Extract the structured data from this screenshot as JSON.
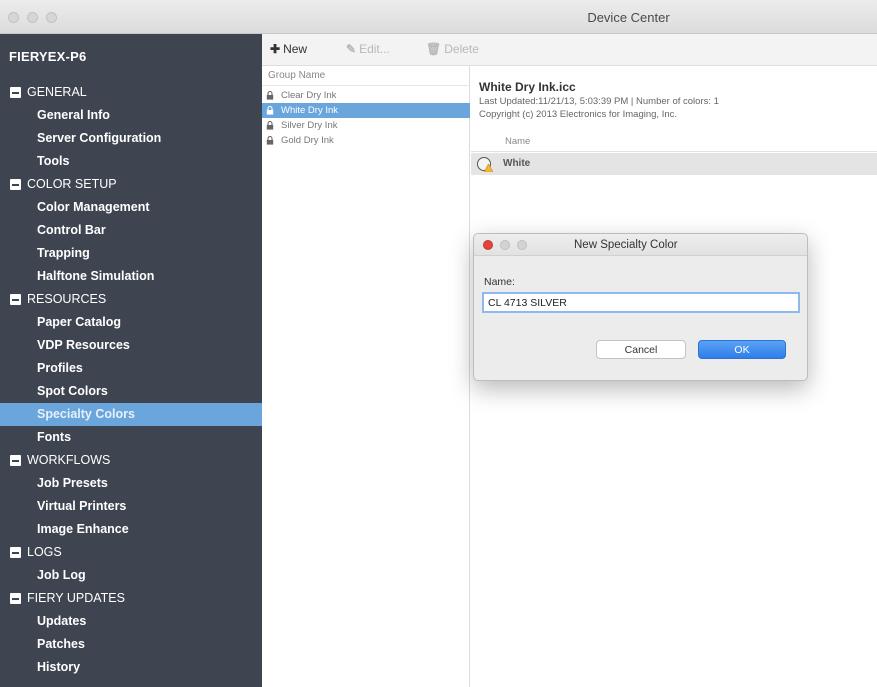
{
  "window": {
    "title": "Device Center"
  },
  "sidebar": {
    "device_name": "FIERYEX-P6",
    "nav": [
      {
        "type": "section",
        "label": "GENERAL"
      },
      {
        "type": "item",
        "label": "General Info"
      },
      {
        "type": "item",
        "label": "Server Configuration"
      },
      {
        "type": "item",
        "label": "Tools"
      },
      {
        "type": "section",
        "label": "COLOR SETUP"
      },
      {
        "type": "item",
        "label": "Color Management"
      },
      {
        "type": "item",
        "label": "Control Bar"
      },
      {
        "type": "item",
        "label": "Trapping"
      },
      {
        "type": "item",
        "label": "Halftone Simulation"
      },
      {
        "type": "section",
        "label": "RESOURCES"
      },
      {
        "type": "item",
        "label": "Paper Catalog"
      },
      {
        "type": "item",
        "label": "VDP Resources"
      },
      {
        "type": "item",
        "label": "Profiles"
      },
      {
        "type": "item",
        "label": "Spot Colors"
      },
      {
        "type": "item",
        "label": "Specialty Colors",
        "selected": true
      },
      {
        "type": "item",
        "label": "Fonts"
      },
      {
        "type": "section",
        "label": "WORKFLOWS"
      },
      {
        "type": "item",
        "label": "Job Presets"
      },
      {
        "type": "item",
        "label": "Virtual Printers"
      },
      {
        "type": "item",
        "label": "Image Enhance"
      },
      {
        "type": "section",
        "label": "LOGS"
      },
      {
        "type": "item",
        "label": "Job Log"
      },
      {
        "type": "section",
        "label": "FIERY UPDATES"
      },
      {
        "type": "item",
        "label": "Updates"
      },
      {
        "type": "item",
        "label": "Patches"
      },
      {
        "type": "item",
        "label": "History"
      }
    ]
  },
  "toolbar": {
    "new_label": "New",
    "edit_label": "Edit...",
    "delete_label": "Delete"
  },
  "groups": {
    "column_header": "Group Name",
    "rows": [
      {
        "name": "Clear Dry Ink",
        "selected": false
      },
      {
        "name": "White Dry Ink",
        "selected": true
      },
      {
        "name": "Silver Dry Ink",
        "selected": false
      },
      {
        "name": "Gold Dry Ink",
        "selected": false
      }
    ]
  },
  "detail": {
    "title": "White Dry Ink.icc",
    "meta": "Last Updated:11/21/13, 5:03:39 PM | Number of colors: 1",
    "copyright": "Copyright (c) 2013 Electronics for Imaging, Inc.",
    "column_header": "Name",
    "rows": [
      {
        "name": "White"
      }
    ]
  },
  "dialog": {
    "title": "New Specialty Color",
    "name_label": "Name:",
    "name_value": "CL 4713 SILVER",
    "cancel_label": "Cancel",
    "ok_label": "OK"
  },
  "colors": {
    "sidebar_bg": "#3e4450",
    "selection": "#6aa6dc",
    "ok_button": "#2f7fe8",
    "close_dot": "#e0443e"
  }
}
